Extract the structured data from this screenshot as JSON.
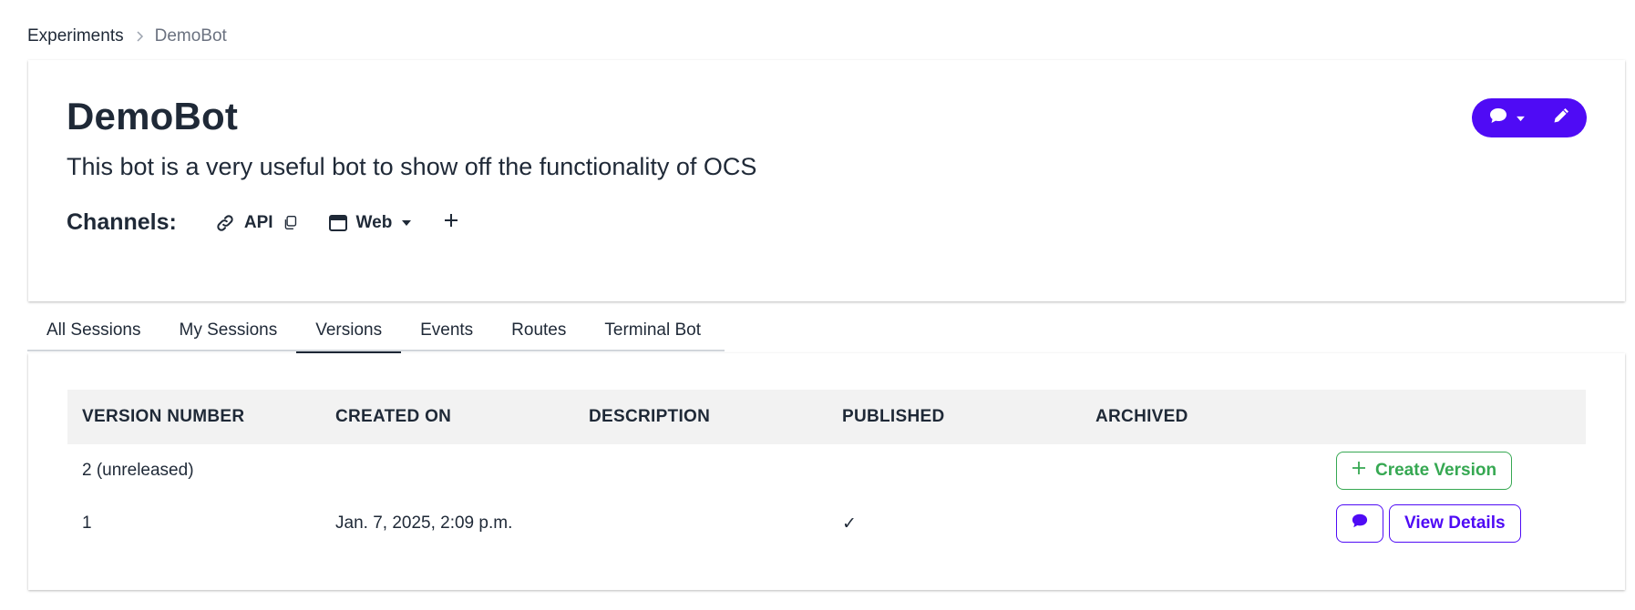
{
  "breadcrumb": {
    "parent": "Experiments",
    "current": "DemoBot"
  },
  "header": {
    "title": "DemoBot",
    "description": "This bot is a very useful bot to show off the functionality of OCS"
  },
  "channels": {
    "label": "Channels:",
    "items": [
      {
        "name": "API",
        "icon": "link-icon",
        "extra_icon": "copy-icon"
      },
      {
        "name": "Web",
        "icon": "browser-window-icon",
        "extra_icon": "caret-down-icon"
      }
    ],
    "add_icon": "plus-icon"
  },
  "tabs": [
    {
      "label": "All Sessions",
      "active": false
    },
    {
      "label": "My Sessions",
      "active": false
    },
    {
      "label": "Versions",
      "active": true
    },
    {
      "label": "Events",
      "active": false
    },
    {
      "label": "Routes",
      "active": false
    },
    {
      "label": "Terminal Bot",
      "active": false
    }
  ],
  "versions_table": {
    "columns": [
      "VERSION NUMBER",
      "CREATED ON",
      "DESCRIPTION",
      "PUBLISHED",
      "ARCHIVED",
      ""
    ],
    "rows": [
      {
        "version": "2 (unreleased)",
        "created_on": "",
        "description": "",
        "published": "",
        "archived": "",
        "action": "Create Version"
      },
      {
        "version": "1",
        "created_on": "Jan. 7, 2025, 2:09 p.m.",
        "description": "",
        "published": "✓",
        "archived": "",
        "action": "View Details"
      }
    ]
  },
  "colors": {
    "primary": "#4f0bf5",
    "success": "#36a852",
    "text": "#1f2937",
    "header_bg": "#f2f2f2"
  }
}
